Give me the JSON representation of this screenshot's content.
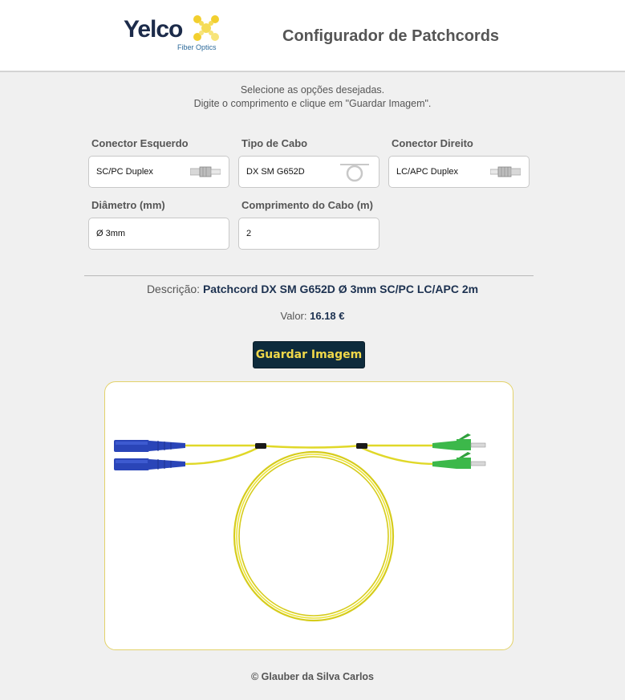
{
  "brand": {
    "name": "Yelco",
    "tagline": "Fiber Optics",
    "colors": {
      "navy": "#1c2b4a",
      "yellow": "#f2cf2e"
    }
  },
  "app": {
    "title": "Configurador de Patchcords"
  },
  "intro": {
    "line1": "Selecione as opções desejadas.",
    "line2": "Digite o comprimento e clique em \"Guardar Imagem\"."
  },
  "fields": {
    "left_connector": {
      "label": "Conector Esquerdo",
      "value": "SC/PC Duplex",
      "icon": "connector-icon"
    },
    "cable_type": {
      "label": "Tipo de Cabo",
      "value": "DX SM G652D",
      "icon": "cable-coil-icon"
    },
    "right_connector": {
      "label": "Conector Direito",
      "value": "LC/APC Duplex",
      "icon": "connector-icon"
    },
    "diameter": {
      "label": "Diâmetro (mm)",
      "value": "Ø 3mm"
    },
    "length": {
      "label": "Comprimento do Cabo (m)",
      "value": "2"
    }
  },
  "summary": {
    "desc_label": "Descrição:",
    "desc_value": "Patchcord DX SM G652D Ø 3mm SC/PC LC/APC 2m",
    "price_label": "Valor:",
    "price_value": "16.18 €"
  },
  "actions": {
    "save_label": "Guardar Imagem"
  },
  "preview": {
    "left_connector_color": "#2a45b8",
    "right_connector_color": "#3cb84a",
    "cable_color": "#e8e02c"
  },
  "footer": {
    "text": "© Glauber da Silva Carlos"
  }
}
